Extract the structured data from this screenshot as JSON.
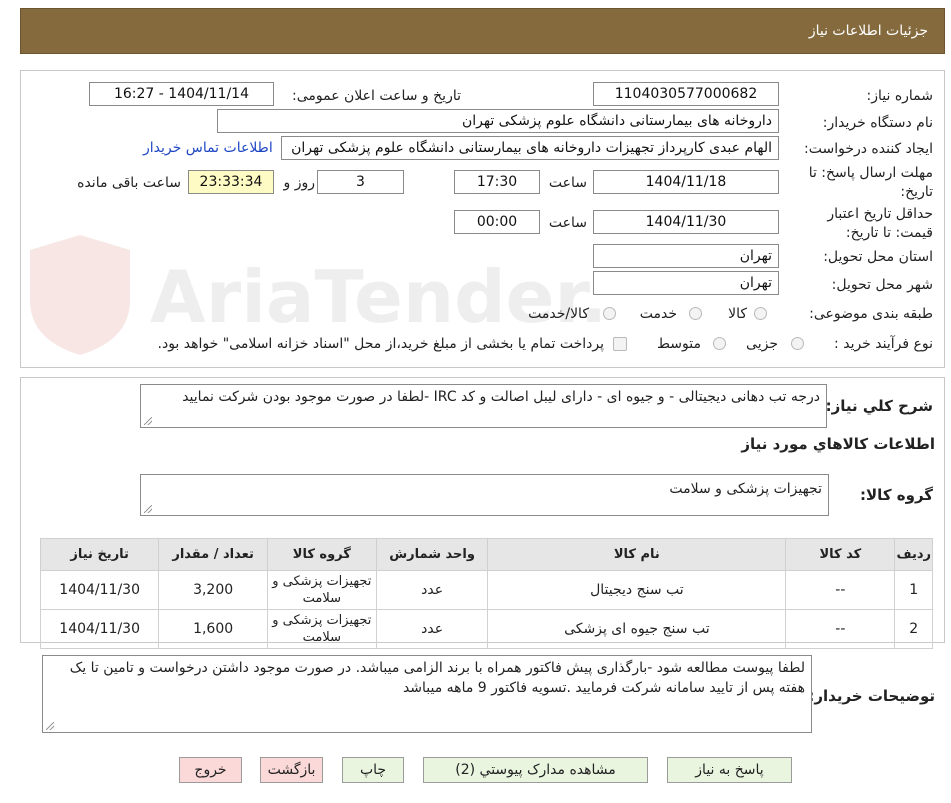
{
  "header": {
    "title": "جزئیات اطلاعات نیاز"
  },
  "watermark": {
    "text": "AriaTender.neT"
  },
  "info": {
    "need_number_label": "شماره نیاز:",
    "need_number": "1104030577000682",
    "announce_label": "تاریخ و ساعت اعلان عمومی:",
    "announce_value": "1404/11/14 - 16:27",
    "buyer_org_label": "نام دستگاه خریدار:",
    "buyer_org": "داروخانه های بیمارستانی دانشگاه علوم پزشکی تهران",
    "creator_label": "ایجاد کننده درخواست:",
    "creator": "الهام عبدی کارپرداز تجهیزات داروخانه های بیمارستانی دانشگاه علوم پزشکی تهران",
    "contact_link": "اطلاعات تماس خریدار",
    "deadline_label_1": "مهلت ارسال پاسخ: تا",
    "deadline_label_2": "تاریخ:",
    "deadline_date": "1404/11/18",
    "time_label": "ساعت",
    "deadline_time": "17:30",
    "days_value": "3",
    "days_label": "روز و",
    "remaining_time": "23:33:34",
    "remaining_label": "ساعت باقی مانده",
    "validity_label_1": "حداقل تاریخ اعتبار",
    "validity_label_2": "قیمت: تا تاریخ:",
    "validity_date": "1404/11/30",
    "validity_time": "00:00",
    "province_label": "استان محل تحویل:",
    "province": "تهران",
    "city_label": "شهر محل تحویل:",
    "city": "تهران",
    "category_label": "طبقه بندی موضوعی:",
    "category_options": [
      "کالا",
      "خدمت",
      "کالا/خدمت"
    ],
    "process_label": "نوع فرآیند خرید :",
    "process_options": [
      "جزیی",
      "متوسط"
    ],
    "payment_note": "پرداخت تمام یا بخشی از مبلغ خرید،از محل \"اسناد خزانه اسلامی\" خواهد بود."
  },
  "summary": {
    "label": "شرح کلي نياز:",
    "text": "درجه تب دهانی دیجیتالی - و جیوه ای - دارای لیبل اصالت و کد IRC -لطفا در صورت موجود بودن شرکت نمایید"
  },
  "goods": {
    "title": "اطلاعات کالاهاي مورد نياز",
    "group_label": "گروه کالا:",
    "group_value": "تجهیزات پزشکی و سلامت"
  },
  "table": {
    "headers": [
      "ردیف",
      "کد کالا",
      "نام کالا",
      "واحد شمارش",
      "گروه کالا",
      "تعداد / مقدار",
      "تاریخ نیاز"
    ],
    "rows": [
      [
        "1",
        "--",
        "تب سنج دیجیتال",
        "عدد",
        "تجهیزات پزشکی و سلامت",
        "3,200",
        "1404/11/30"
      ],
      [
        "2",
        "--",
        "تب سنج جیوه ای پزشکی",
        "عدد",
        "تجهیزات پزشکی و سلامت",
        "1,600",
        "1404/11/30"
      ]
    ]
  },
  "buyer_notes": {
    "label": "توضیحات خریدار:",
    "text": "لطفا پیوست مطالعه شود -بارگذاری پیش فاکتور همراه با برند الزامی میباشد. در صورت موجود داشتن درخواست و تامین تا یک هفته پس از تایید سامانه شرکت فرمایید .تسویه فاکتور 9 ماهه میباشد"
  },
  "buttons": {
    "respond": "پاسخ به نیاز",
    "attachments": "مشاهده مدارک پیوستي (2)",
    "print": "چاپ",
    "back": "بازگشت",
    "exit": "خروج"
  },
  "colors": {
    "header_bg": "#856a3e",
    "button_green": "#eaf5e0",
    "button_pink": "#fbd9d9",
    "remaining_bg": "#fffbc4",
    "link": "#1f47c4"
  }
}
